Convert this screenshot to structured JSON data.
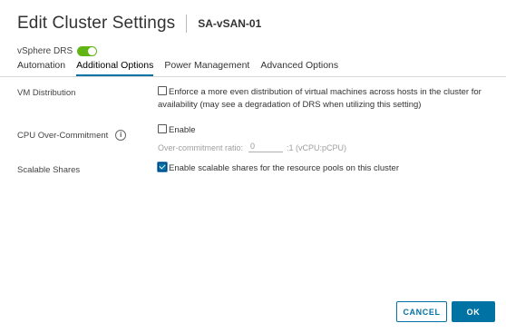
{
  "dialog": {
    "title": "Edit Cluster Settings",
    "cluster_name": "SA-vSAN-01"
  },
  "drs": {
    "label": "vSphere DRS",
    "enabled": true
  },
  "tabs": [
    {
      "label": "Automation",
      "active": false
    },
    {
      "label": "Additional Options",
      "active": true
    },
    {
      "label": "Power Management",
      "active": false
    },
    {
      "label": "Advanced Options",
      "active": false
    }
  ],
  "settings": {
    "vm_distribution": {
      "label": "VM Distribution",
      "checkbox_text_line1": "Enforce a more even distribution of virtual machines across hosts in the cluster for",
      "checkbox_text_line2": "availability (may see a degradation of DRS when utilizing this setting)",
      "checked": false
    },
    "cpu_overcommit": {
      "label": "CPU Over-Commitment",
      "info_icon": "info-icon",
      "checkbox_text": "Enable",
      "checked": false,
      "ratio_label": "Over-commitment ratio:",
      "ratio_value": "0",
      "ratio_unit": ":1 (vCPU:pCPU)"
    },
    "scalable_shares": {
      "label": "Scalable Shares",
      "checkbox_text": "Enable scalable shares for the resource pools on this cluster",
      "checked": true
    }
  },
  "footer": {
    "cancel_label": "CANCEL",
    "ok_label": "OK"
  },
  "colors": {
    "accent": "#0072a3",
    "toggle_on": "#60b515"
  }
}
